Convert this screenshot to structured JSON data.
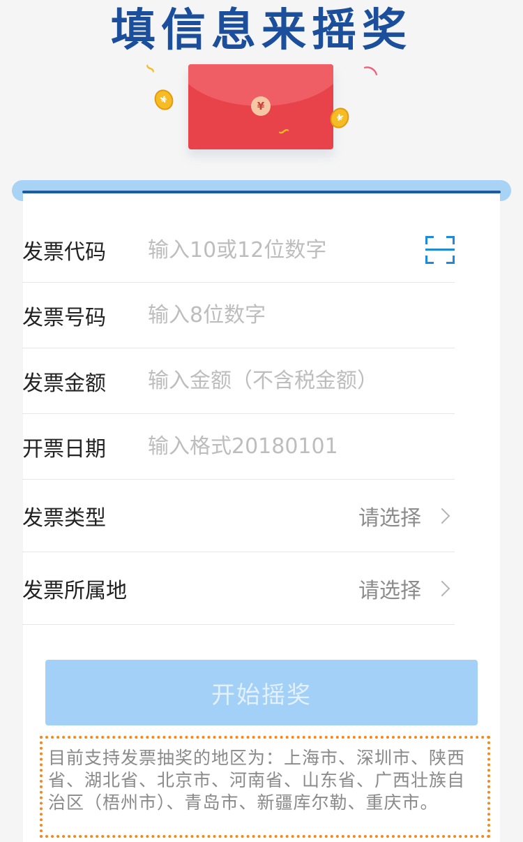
{
  "header": {
    "title": "填信息来摇奖"
  },
  "hero": {
    "envelope_symbol": "¥",
    "coin_symbol": "¥",
    "icons": [
      "red-envelope-icon",
      "coin-icon",
      "streamer-icon"
    ],
    "colors": {
      "envelope": "#e8424b",
      "coin": "#f5bd23",
      "title": "#1b4f9c"
    }
  },
  "form": {
    "invoice_code": {
      "label": "发票代码",
      "placeholder": "输入10或12位数字",
      "icon": "scan-icon"
    },
    "invoice_number": {
      "label": "发票号码",
      "placeholder": "输入8位数字"
    },
    "invoice_amount": {
      "label": "发票金额",
      "placeholder": "输入金额（不含税金额）"
    },
    "invoice_date": {
      "label": "开票日期",
      "placeholder": "输入格式20180101"
    },
    "invoice_type": {
      "label": "发票类型",
      "value": "请选择"
    },
    "invoice_region": {
      "label": "发票所属地",
      "value": "请选择"
    }
  },
  "start_button": {
    "label": "开始摇奖",
    "color": "#a3d0f6"
  },
  "notice": {
    "text": "目前支持发票抽奖的地区为：上海市、深圳市、陕西省、湖北省、北京市、河南省、山东省、广西壮族自治区（梧州市）、青岛市、新疆库尔勒、重庆市。",
    "border_color": "#f2891d"
  }
}
